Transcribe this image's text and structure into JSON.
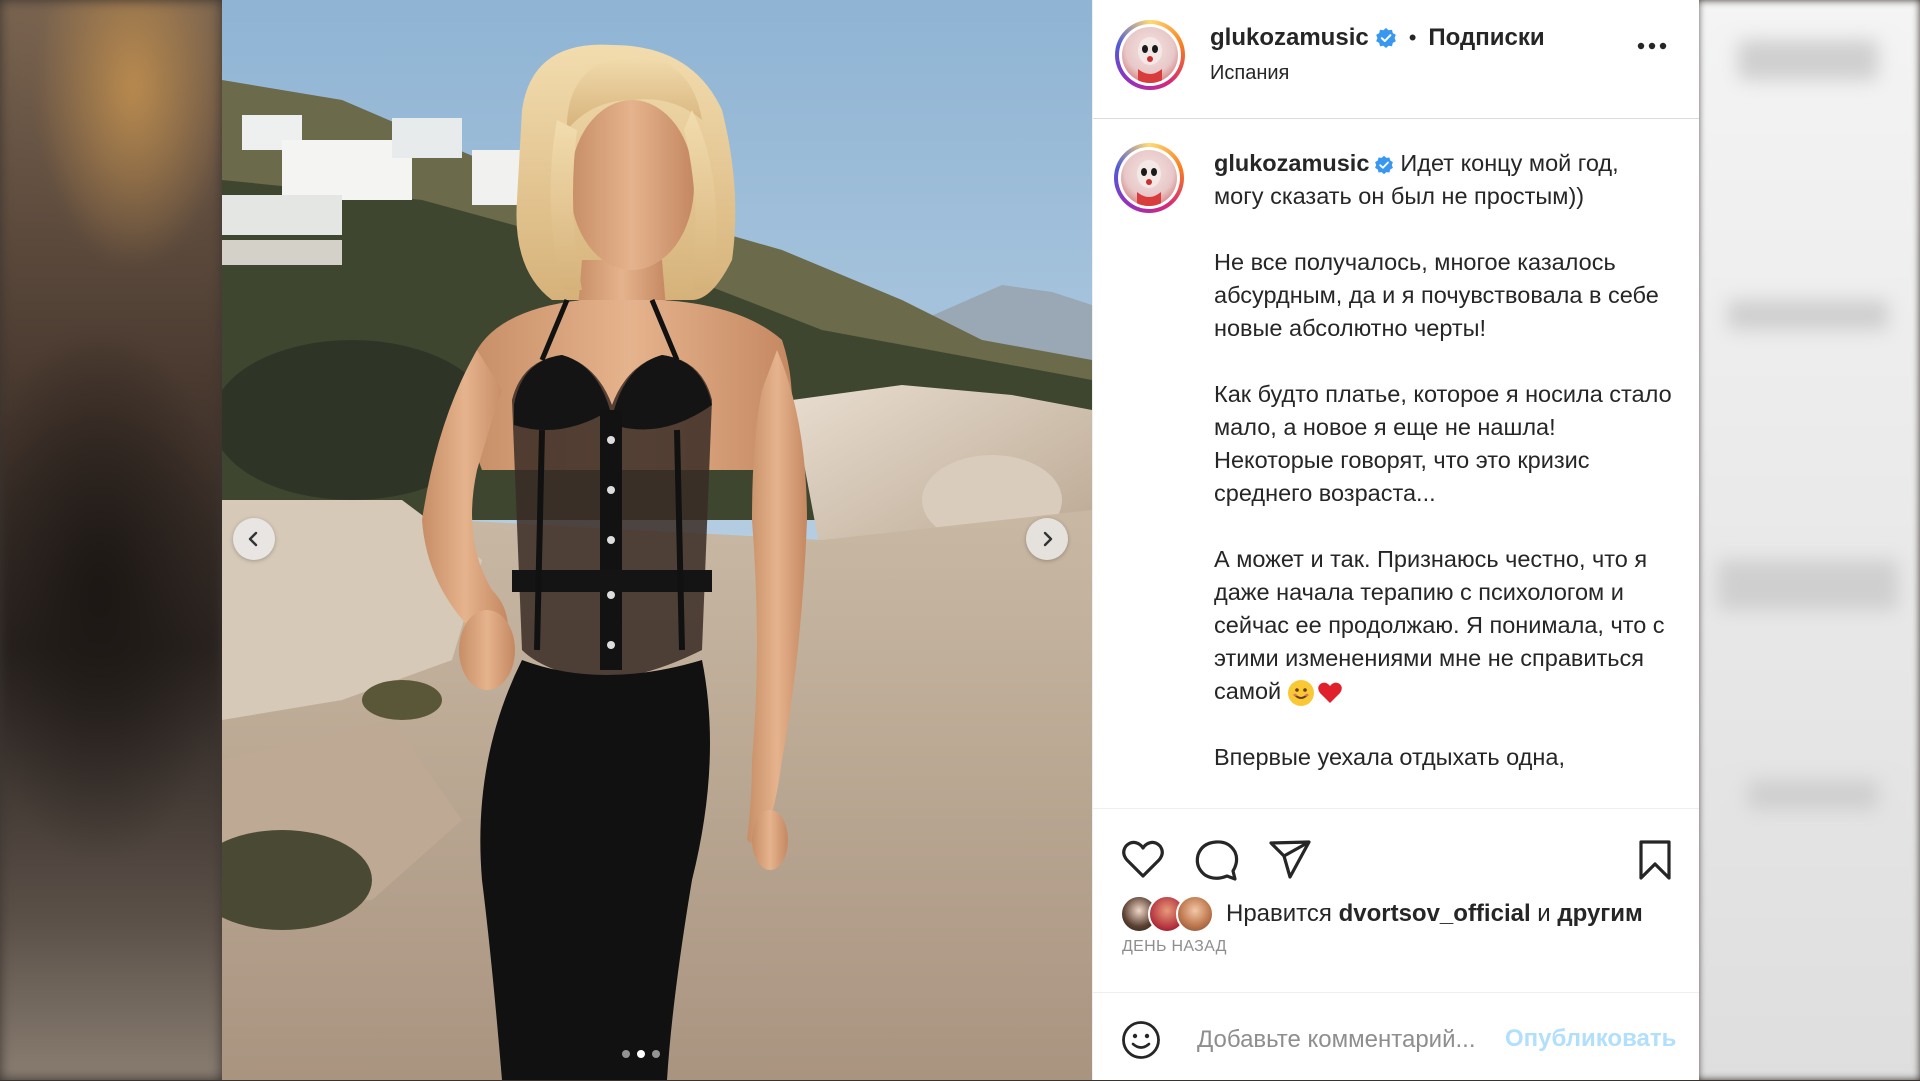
{
  "post": {
    "username": "glukozamusic",
    "follow_status": "Подписки",
    "separator": "•",
    "location": "Испания",
    "caption_intro": "Идет концу мой год, могу сказать он был не простым))",
    "caption_body": "Не все получалось, многое казалось абсурдным, да и я почувствовала в себе новые абсолютно черты!\n\nКак будто платье, которое я носила стало мало, а новое я еще не нашла! Некоторые говорят, что это кризис среднего возраста...\n\nА может и так. Признаюсь честно, что я даже начала терапию с психологом и сейчас ее продолжаю. Я понимала, что с этими изменениями мне не справиться самой",
    "caption_more": "Впервые уехала отдыхать одна,",
    "likes_prefix": "Нравится",
    "likes_user": "dvortsov_official",
    "likes_conj": "и",
    "likes_suffix": "другим",
    "time_ago": "ДЕНЬ НАЗАД"
  },
  "carousel": {
    "total": 3,
    "active": 2
  },
  "comment": {
    "placeholder": "Добавьте комментарий...",
    "publish_label": "Опубликовать"
  },
  "icons": {
    "verified": "verified-badge-icon",
    "more": "more-options-icon",
    "like": "heart-icon",
    "comment": "comment-bubble-icon",
    "share": "paper-plane-icon",
    "save": "bookmark-icon",
    "emoji": "emoji-icon",
    "prev": "chevron-left-icon",
    "next": "chevron-right-icon"
  },
  "colors": {
    "verified": "#3897f0",
    "publish": "#b2dffc",
    "muted": "#8e8e8e",
    "text": "#262626"
  }
}
